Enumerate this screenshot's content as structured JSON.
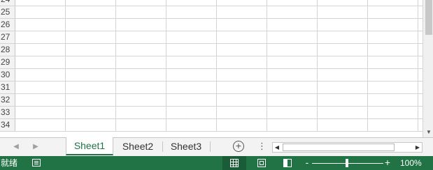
{
  "grid": {
    "row_numbers": [
      "24",
      "25",
      "26",
      "27",
      "28",
      "29",
      "30",
      "31",
      "32",
      "33",
      "34"
    ]
  },
  "sheet_tabs": [
    {
      "label": "Sheet1",
      "active": true
    },
    {
      "label": "Sheet2",
      "active": false
    },
    {
      "label": "Sheet3",
      "active": false
    }
  ],
  "tabbar": {
    "prev_icon": "caret-left-icon",
    "next_icon": "caret-right-icon",
    "add_sheet_icon": "plus-circle-icon",
    "more_icon": "vertical-ellipsis-icon"
  },
  "status": {
    "ready_label": "就绪",
    "zoom_minus": "-",
    "zoom_plus": "+",
    "zoom_label": "100%",
    "zoom_level": 100
  },
  "colors": {
    "accent": "#217346",
    "status_bg": "#217346",
    "active_view_bg": "#1a5c38",
    "gridline": "#d4d4d4"
  }
}
